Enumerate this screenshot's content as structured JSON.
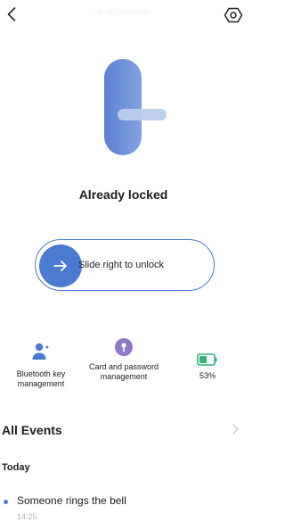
{
  "header": {
    "title": "·· ·· ·········",
    "back_icon": "chevron-left-icon",
    "settings_icon": "hexagon-gear-icon"
  },
  "lock": {
    "status": "Already locked",
    "illustration": "door-lock-handle",
    "colors": {
      "body": "#6d8fd6",
      "handle": "#b9cbea"
    }
  },
  "slider": {
    "label": "Slide right to unlock",
    "knob_icon": "arrow-right-icon",
    "accent": "#4b7bd0"
  },
  "functions": [
    {
      "label": "Bluetooth key management",
      "icon": "person-key-icon",
      "color": "#4b7bd0"
    },
    {
      "label": "Card and password management",
      "icon": "key-badge-icon",
      "color": "#8e79cc"
    },
    {
      "label": "53%",
      "icon": "battery-icon",
      "color": "#33b27a",
      "battery_level": 0.53
    }
  ],
  "events": {
    "title": "All Events",
    "group_label": "Today",
    "items": [
      {
        "text": "Someone rings the bell",
        "time": "14:25"
      }
    ]
  }
}
